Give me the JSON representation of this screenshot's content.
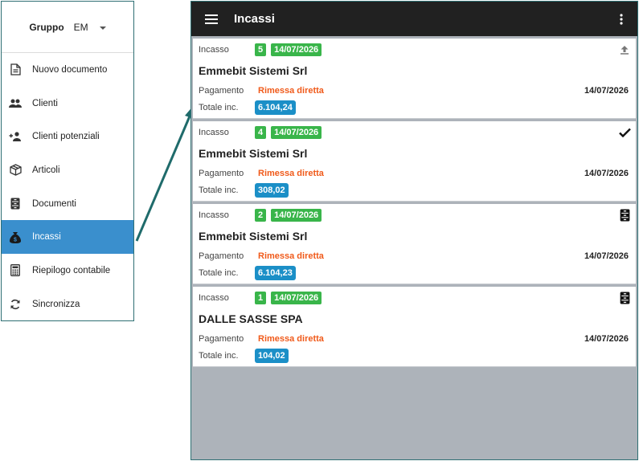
{
  "drawer": {
    "group_label": "Gruppo",
    "group_value": "EM",
    "items": [
      {
        "label": "Nuovo documento",
        "icon": "document-icon"
      },
      {
        "label": "Clienti",
        "icon": "people-icon"
      },
      {
        "label": "Clienti potenziali",
        "icon": "person-add-icon"
      },
      {
        "label": "Articoli",
        "icon": "box-icon"
      },
      {
        "label": "Documenti",
        "icon": "cabinet-icon"
      },
      {
        "label": "Incassi",
        "icon": "money-bag-icon",
        "active": true
      },
      {
        "label": "Riepilogo contabile",
        "icon": "calculator-icon"
      },
      {
        "label": "Sincronizza",
        "icon": "sync-icon"
      }
    ]
  },
  "app": {
    "title": "Incassi",
    "colors": {
      "topbar": "#212121",
      "badge_green": "#39b54a",
      "badge_blue": "#1b8fc7",
      "payment": "#f05a1a",
      "active_menu": "#3a8fcd"
    },
    "labels": {
      "incasso": "Incasso",
      "pagamento": "Pagamento",
      "totale": "Totale inc."
    },
    "cards": [
      {
        "number": "5",
        "date": "14/07/2026",
        "client": "Emmebit Sistemi Srl",
        "payment": "Rimessa diretta",
        "doc_date": "14/07/2026",
        "total": "6.104,24",
        "status_icon": "upload-icon"
      },
      {
        "number": "4",
        "date": "14/07/2026",
        "client": "Emmebit Sistemi Srl",
        "payment": "Rimessa diretta",
        "doc_date": "14/07/2026",
        "total": "308,02",
        "status_icon": "check-icon"
      },
      {
        "number": "2",
        "date": "14/07/2026",
        "client": "Emmebit Sistemi Srl",
        "payment": "Rimessa diretta",
        "doc_date": "14/07/2026",
        "total": "6.104,23",
        "status_icon": "cabinet-icon"
      },
      {
        "number": "1",
        "date": "14/07/2026",
        "client": "DALLE SASSE SPA",
        "payment": "Rimessa diretta",
        "doc_date": "14/07/2026",
        "total": "104,02",
        "status_icon": "cabinet-icon"
      }
    ]
  }
}
